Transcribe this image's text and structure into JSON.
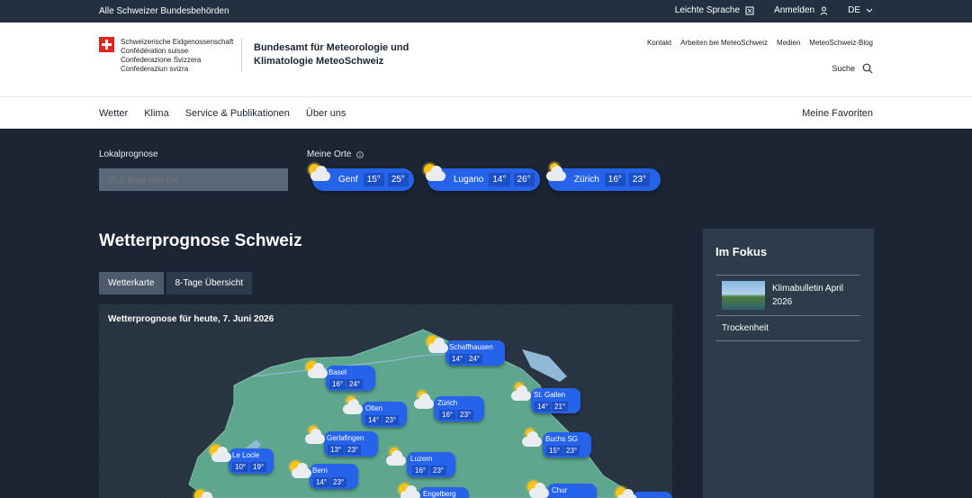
{
  "topbar": {
    "authorities": "Alle Schweizer Bundesbehörden",
    "easy_language": "Leichte Sprache",
    "login": "Anmelden",
    "language": "DE"
  },
  "header": {
    "confed_lines": [
      "Schweizerische Eidgenossenschaft",
      "Confédération suisse",
      "Confederazione Svizzera",
      "Confederaziun svizra"
    ],
    "office_line1": "Bundesamt für Meteorologie und",
    "office_line2": "Klimatologie MeteoSchweiz",
    "links": [
      "Kontakt",
      "Arbeiten bei MeteoSchweiz",
      "Medien",
      "MeteoSchweiz-Blog"
    ],
    "search_label": "Suche"
  },
  "nav": {
    "items": [
      "Wetter",
      "Klima",
      "Service & Publikationen",
      "Über uns"
    ],
    "favorites": "Meine Favoriten"
  },
  "lokal": {
    "label": "Lokalprognose",
    "placeholder": "PLZ, Berg oder Ort"
  },
  "orte": {
    "label": "Meine Orte",
    "places": [
      {
        "city": "Genf",
        "min": "15°",
        "max": "25°",
        "icon": "sun-cloud-icon"
      },
      {
        "city": "Lugano",
        "min": "14°",
        "max": "26°",
        "icon": "sun-cloud-icon"
      },
      {
        "city": "Zürich",
        "min": "16°",
        "max": "23°",
        "icon": "cloudy-icon"
      }
    ]
  },
  "main": {
    "title": "Wetterprognose Schweiz",
    "tabs": [
      "Wetterkarte",
      "8-Tage Übersicht"
    ],
    "map_title": "Wetterprognose für heute, 7. Juni 2026"
  },
  "map_points": [
    {
      "name": "Schaffhausen",
      "min": "14°",
      "max": "24°"
    },
    {
      "name": "Basel",
      "min": "16°",
      "max": "24°"
    },
    {
      "name": "Zürich",
      "min": "16°",
      "max": "23°"
    },
    {
      "name": "St. Gallen",
      "min": "14°",
      "max": "21°"
    },
    {
      "name": "Olten",
      "min": "14°",
      "max": "23°"
    },
    {
      "name": "Gerlafingen",
      "min": "13°",
      "max": "23°"
    },
    {
      "name": "Buchs SG",
      "min": "15°",
      "max": "23°"
    },
    {
      "name": "Le Locle",
      "min": "10°",
      "max": "19°"
    },
    {
      "name": "Luzern",
      "min": "16°",
      "max": "23°"
    },
    {
      "name": "Bern",
      "min": "14°",
      "max": "23°"
    },
    {
      "name": "Engelberg",
      "min": "",
      "max": ""
    },
    {
      "name": "Chur",
      "min": "",
      "max": ""
    }
  ],
  "fokus": {
    "title": "Im Fokus",
    "item1": "Klimabulletin April 2026",
    "item2": "Trockenheit"
  },
  "colors": {
    "accent_blue": "#2563eb",
    "dark_bg": "#1b2533",
    "panel_bg": "#2e3b4a"
  }
}
